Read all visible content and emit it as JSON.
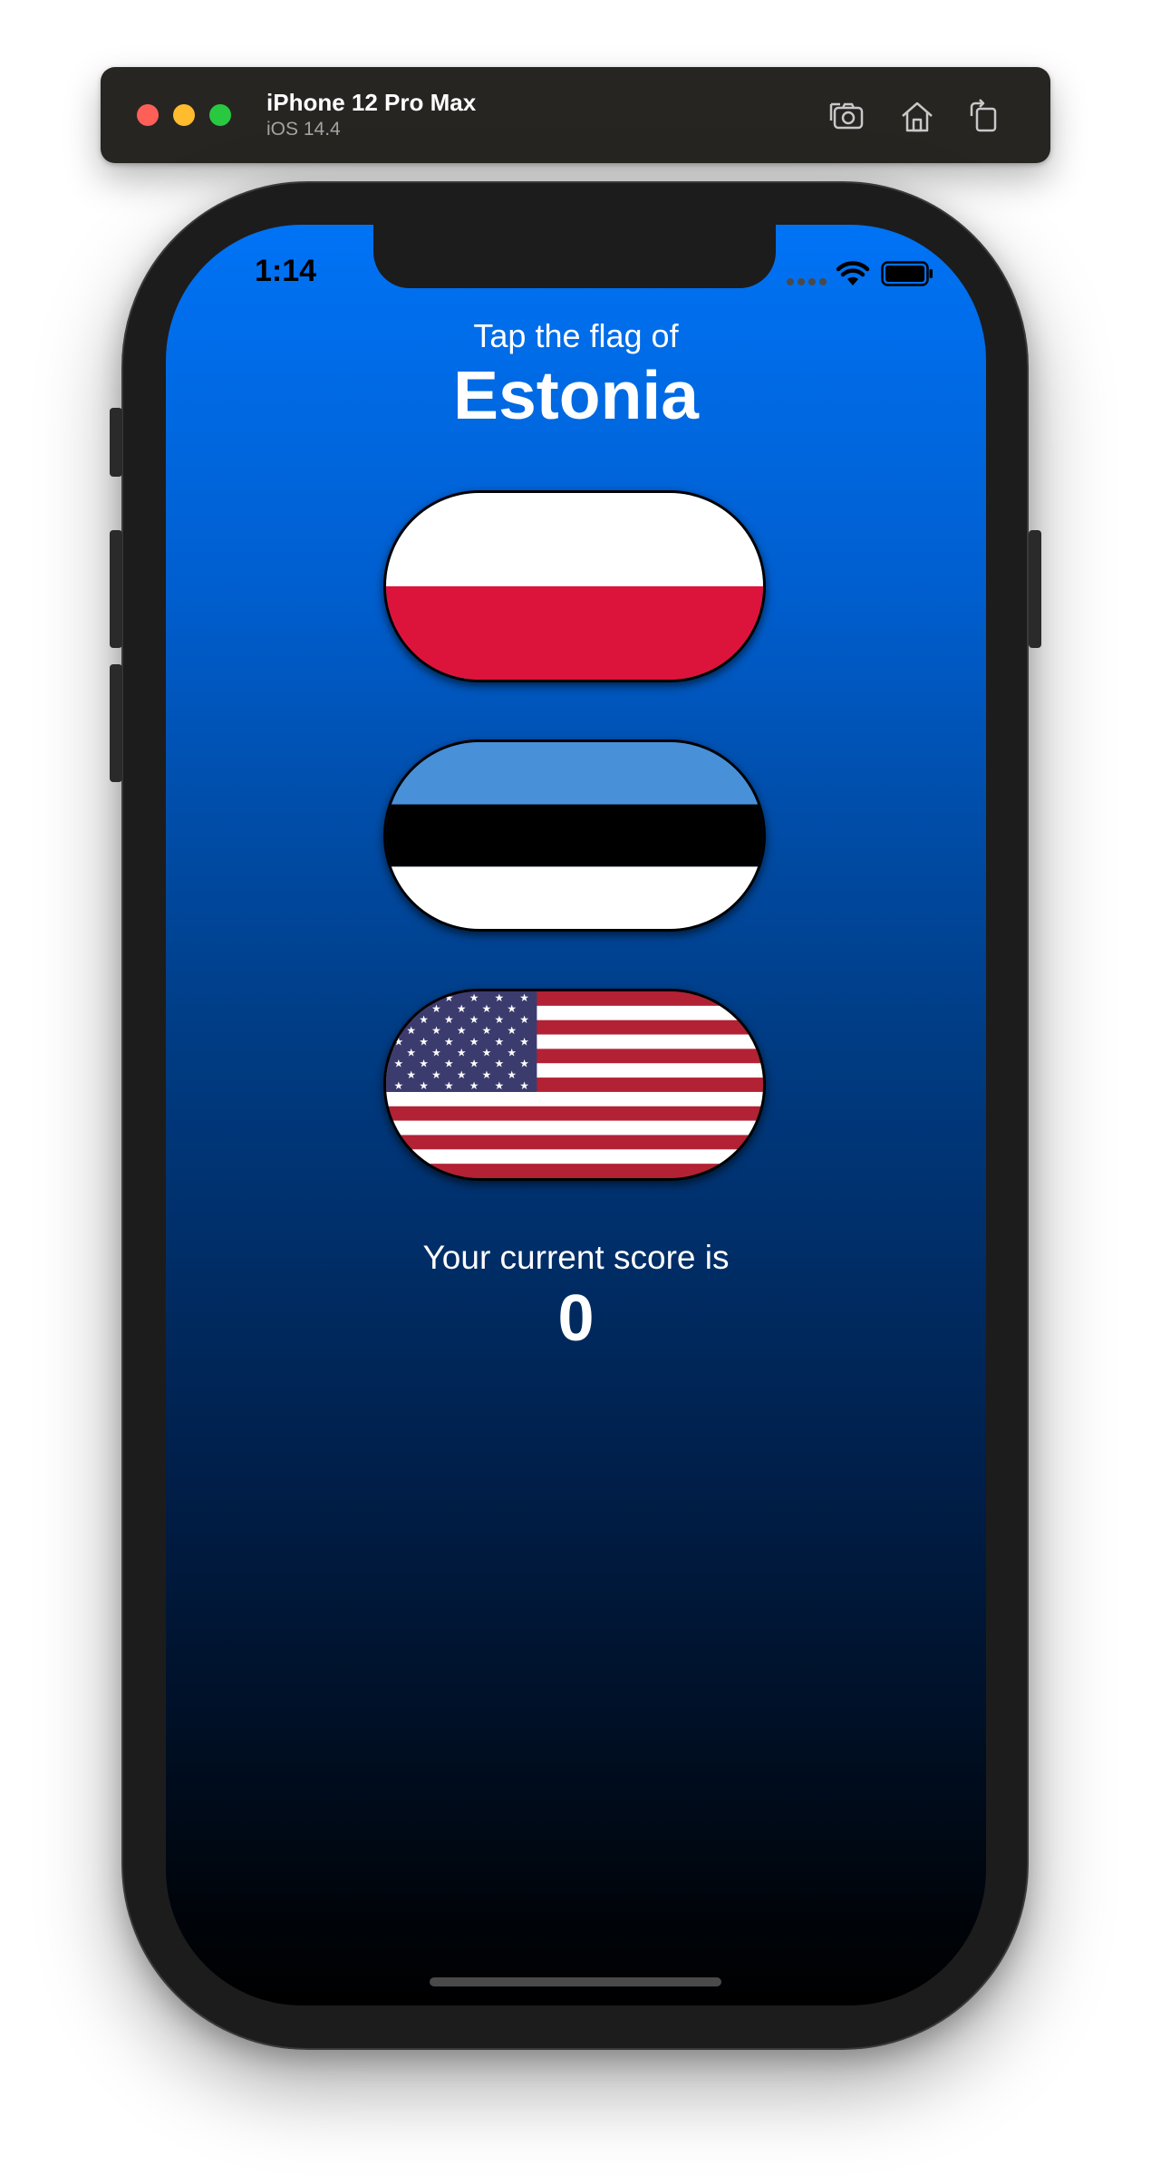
{
  "simulator": {
    "device_name": "iPhone 12 Pro Max",
    "os_version": "iOS 14.4",
    "toolbar_icons": [
      "screenshot-icon",
      "home-icon",
      "rotate-icon"
    ]
  },
  "status_bar": {
    "time": "1:14"
  },
  "game": {
    "prompt": "Tap the flag of",
    "country": "Estonia",
    "flags": [
      "Poland",
      "Estonia",
      "United States"
    ],
    "score_label": "Your current score is",
    "score": "0"
  },
  "colors": {
    "gradient_top": "#0073f5",
    "gradient_bottom": "#000000",
    "poland_red": "#dc143c",
    "estonia_blue": "#4891d9",
    "usa_red": "#b22234",
    "usa_blue": "#3c3b6e"
  }
}
